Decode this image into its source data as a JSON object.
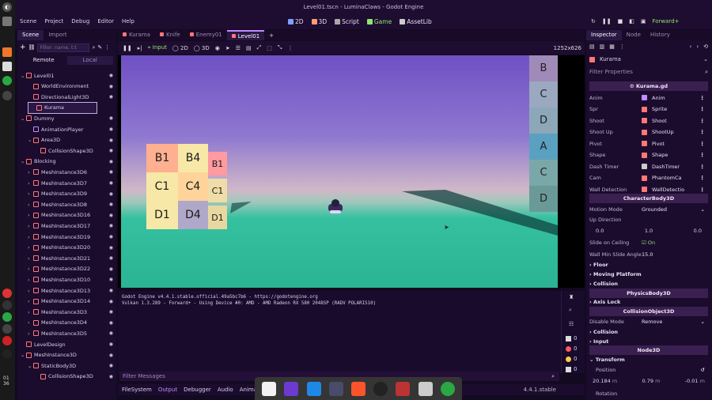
{
  "window": {
    "title": "Level01.tscn - LuminaClaws - Godot Engine"
  },
  "menu": [
    "Scene",
    "Project",
    "Debug",
    "Editor",
    "Help"
  ],
  "workspaces": [
    {
      "label": "2D",
      "color": "#7aa2ff"
    },
    {
      "label": "3D",
      "color": "#ff9b78"
    },
    {
      "label": "Script",
      "color": "#aaaaaa"
    },
    {
      "label": "Game",
      "color": "#8ee66e"
    },
    {
      "label": "AssetLib",
      "color": "#cccccc"
    }
  ],
  "renderer": "Forward+",
  "scene_dock": {
    "tabs": [
      "Scene",
      "Import"
    ],
    "filter_placeholder": "Filter: name, t:t",
    "remote_label": "Remote",
    "local_label": "Local",
    "tree": [
      {
        "label": "Level01",
        "indent": 0,
        "color": "#ff7777",
        "arrow": "v"
      },
      {
        "label": "WorldEnvironment",
        "indent": 1,
        "color": "#ff7777",
        "arrow": ""
      },
      {
        "label": "DirectionalLight3D",
        "indent": 1,
        "color": "#ff7777",
        "arrow": ""
      },
      {
        "label": "Kurama",
        "indent": 1,
        "color": "#ff7777",
        "arrow": "",
        "selected": true
      },
      {
        "label": "Dummy",
        "indent": 0,
        "color": "#ff7777",
        "arrow": "v"
      },
      {
        "label": "AnimationPlayer",
        "indent": 1,
        "color": "#c08cff",
        "arrow": ""
      },
      {
        "label": "Area3D",
        "indent": 1,
        "color": "#ff7777",
        "arrow": "v"
      },
      {
        "label": "CollisionShape3D",
        "indent": 2,
        "color": "#ff7777",
        "arrow": ""
      },
      {
        "label": "Blocking",
        "indent": 0,
        "color": "#ff7777",
        "arrow": "v"
      },
      {
        "label": "MeshInstance3D6",
        "indent": 1,
        "color": "#ff7777",
        "arrow": ">"
      },
      {
        "label": "MeshInstance3D7",
        "indent": 1,
        "color": "#ff7777",
        "arrow": ">"
      },
      {
        "label": "MeshInstance3D9",
        "indent": 1,
        "color": "#ff7777",
        "arrow": ">"
      },
      {
        "label": "MeshInstance3D8",
        "indent": 1,
        "color": "#ff7777",
        "arrow": ">"
      },
      {
        "label": "MeshInstance3D16",
        "indent": 1,
        "color": "#ff7777",
        "arrow": ">"
      },
      {
        "label": "MeshInstance3D17",
        "indent": 1,
        "color": "#ff7777",
        "arrow": ">"
      },
      {
        "label": "MeshInstance3D19",
        "indent": 1,
        "color": "#ff7777",
        "arrow": ">"
      },
      {
        "label": "MeshInstance3D20",
        "indent": 1,
        "color": "#ff7777",
        "arrow": ">"
      },
      {
        "label": "MeshInstance3D21",
        "indent": 1,
        "color": "#ff7777",
        "arrow": ">"
      },
      {
        "label": "MeshInstance3D22",
        "indent": 1,
        "color": "#ff7777",
        "arrow": ">"
      },
      {
        "label": "MeshInstance3D10",
        "indent": 1,
        "color": "#ff7777",
        "arrow": ">"
      },
      {
        "label": "MeshInstance3D13",
        "indent": 1,
        "color": "#ff7777",
        "arrow": ">"
      },
      {
        "label": "MeshInstance3D14",
        "indent": 1,
        "color": "#ff7777",
        "arrow": ">"
      },
      {
        "label": "MeshInstance3D3",
        "indent": 1,
        "color": "#ff7777",
        "arrow": ">"
      },
      {
        "label": "MeshInstance3D4",
        "indent": 1,
        "color": "#ff7777",
        "arrow": ">"
      },
      {
        "label": "MeshInstance3D5",
        "indent": 1,
        "color": "#ff7777",
        "arrow": ">"
      },
      {
        "label": "LevelDesign",
        "indent": 0,
        "color": "#ff7777",
        "arrow": ""
      },
      {
        "label": "MeshInstance3D",
        "indent": 0,
        "color": "#ff7777",
        "arrow": "v"
      },
      {
        "label": "StaticBody3D",
        "indent": 1,
        "color": "#ff7777",
        "arrow": "v"
      },
      {
        "label": "CollisionShape3D",
        "indent": 2,
        "color": "#ff7777",
        "arrow": ""
      }
    ]
  },
  "editor_tabs": [
    "Kurama",
    "Knife",
    "Enemy01",
    "Level01"
  ],
  "active_tab": "Level01",
  "viewport_toolbar": {
    "input": "Input",
    "d2": "2D",
    "d3": "3D",
    "resolution": "1252x626"
  },
  "blocks_left": [
    "B1",
    "B4",
    "B1",
    "C1",
    "C4",
    "C1",
    "D1",
    "D4",
    "D1"
  ],
  "blocks_right": [
    "B",
    "C",
    "D",
    "A",
    "C",
    "D"
  ],
  "output": {
    "lines": [
      "Godot Engine v4.4.1.stable.official.49a5bc7b6 - https://godotengine.org",
      "Vulkan 1.3.289 - Forward+ - Using Device #0: AMD - AMD Radeon RX 580 2048SP (RADV POLARIS10)"
    ],
    "filter_placeholder": "Filter Messages",
    "counts": [
      "0",
      "0",
      "0",
      "0"
    ]
  },
  "bottom_tabs": [
    "FileSystem",
    "Output",
    "Debugger",
    "Audio",
    "Animation"
  ],
  "version": "4.4.1.stable",
  "inspector": {
    "tabs": [
      "Inspector",
      "Node",
      "History"
    ],
    "node_name": "Kurama",
    "filter_placeholder": "Filter Properties",
    "script": "Kurama.gd",
    "props": [
      {
        "label": "Anim",
        "value": "Anim",
        "color": "#c08cff"
      },
      {
        "label": "Spr",
        "value": "Sprite",
        "color": "#ff7777"
      },
      {
        "label": "Shoot",
        "value": "Shoot",
        "color": "#ff7777"
      },
      {
        "label": "Shoot Up",
        "value": "ShootUp",
        "color": "#ff7777"
      },
      {
        "label": "Pivot",
        "value": "Pivot",
        "color": "#ff7777"
      },
      {
        "label": "Shape",
        "value": "Shape",
        "color": "#ff7777"
      },
      {
        "label": "Dash Timer",
        "value": "DashTimer",
        "color": "#cccccc"
      },
      {
        "label": "Cam",
        "value": "PhantomCa",
        "color": "#ff7777"
      },
      {
        "label": "Wall Detection",
        "value": "WallDetectio",
        "color": "#ff7777"
      }
    ],
    "charbody": "CharacterBody3D",
    "motion_mode_label": "Motion Mode",
    "motion_mode": "Grounded",
    "up_direction_label": "Up Direction",
    "up_direction": [
      "0.0",
      "1.0",
      "0.0"
    ],
    "slide_label": "Slide on Ceiling",
    "slide_value": "On",
    "wall_min_label": "Wall Min Slide Angle",
    "wall_min_value": "15.0",
    "groups1": [
      "Floor",
      "Moving Platform",
      "Collision"
    ],
    "physics": "PhysicsBody3D",
    "axis_lock": "Axis Lock",
    "collobj": "CollisionObject3D",
    "disable_label": "Disable Mode",
    "disable_value": "Remove",
    "groups2": [
      "Collision",
      "Input"
    ],
    "node3d": "Node3D",
    "transform": "Transform",
    "position_label": "Position",
    "position": [
      "20.184",
      "0.79",
      "-0.01"
    ],
    "unit": "m",
    "rotation_label": "Rotation"
  }
}
